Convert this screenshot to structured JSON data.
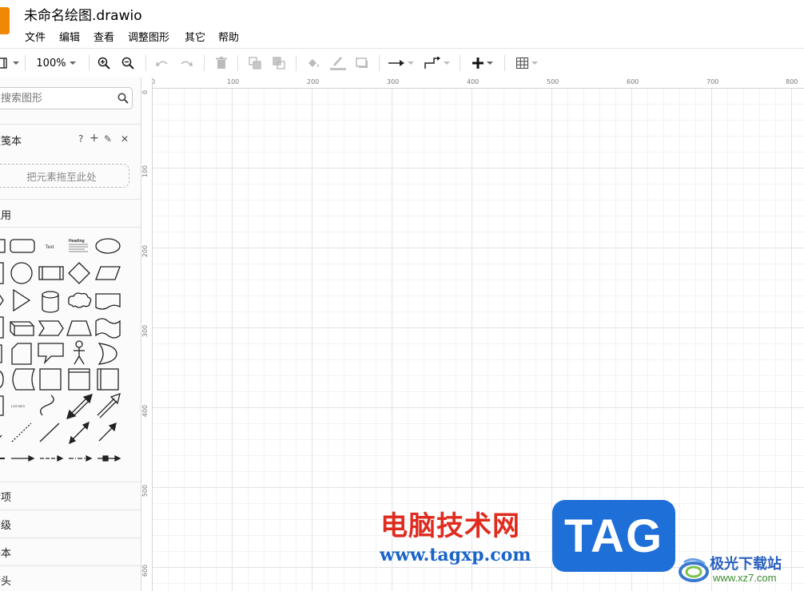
{
  "window": {
    "doc_title": "未命名绘图.drawio",
    "menu": [
      "文件",
      "编辑",
      "查看",
      "调整图形",
      "其它",
      "帮助"
    ]
  },
  "toolbar": {
    "zoom": "100%",
    "items": [
      "view-panels-icon",
      "zoom-in-icon",
      "zoom-out-icon",
      "undo-icon",
      "redo-icon",
      "delete-icon",
      "to-front-icon",
      "to-back-icon",
      "fill-color-icon",
      "line-color-icon",
      "shadow-icon",
      "connection-icon",
      "waypoints-icon",
      "insert-icon",
      "table-icon"
    ]
  },
  "sidebar": {
    "search_placeholder": "搜索图形",
    "scratchpad_title": "便笺本",
    "scratchpad_tools": [
      "?",
      "+",
      "✎",
      "✕"
    ],
    "drop_zone": "把元素拖至此处",
    "general_title": "通用",
    "shape_text_label": "Text",
    "shape_heading_label": "Heading",
    "shape_list_label": "List Item",
    "collapsed_sections": [
      "杂项",
      "高级",
      "基本",
      "箭头"
    ]
  },
  "canvas": {
    "ruler_top": [
      "0",
      "100",
      "200",
      "300",
      "400",
      "500",
      "600",
      "700",
      "800"
    ],
    "ruler_left": [
      "0",
      "100",
      "200",
      "300",
      "400",
      "500",
      "600"
    ]
  },
  "watermark": {
    "cn_name": "电脑技术网",
    "url": "www.tagxp.com",
    "tag": "TAG",
    "site2_name": "极光下载站",
    "site2_url": "www.xz7.com"
  },
  "colors": {
    "logo": "#f08705",
    "wm_red": "#e02b1f",
    "wm_blue": "#1f6fd9"
  }
}
